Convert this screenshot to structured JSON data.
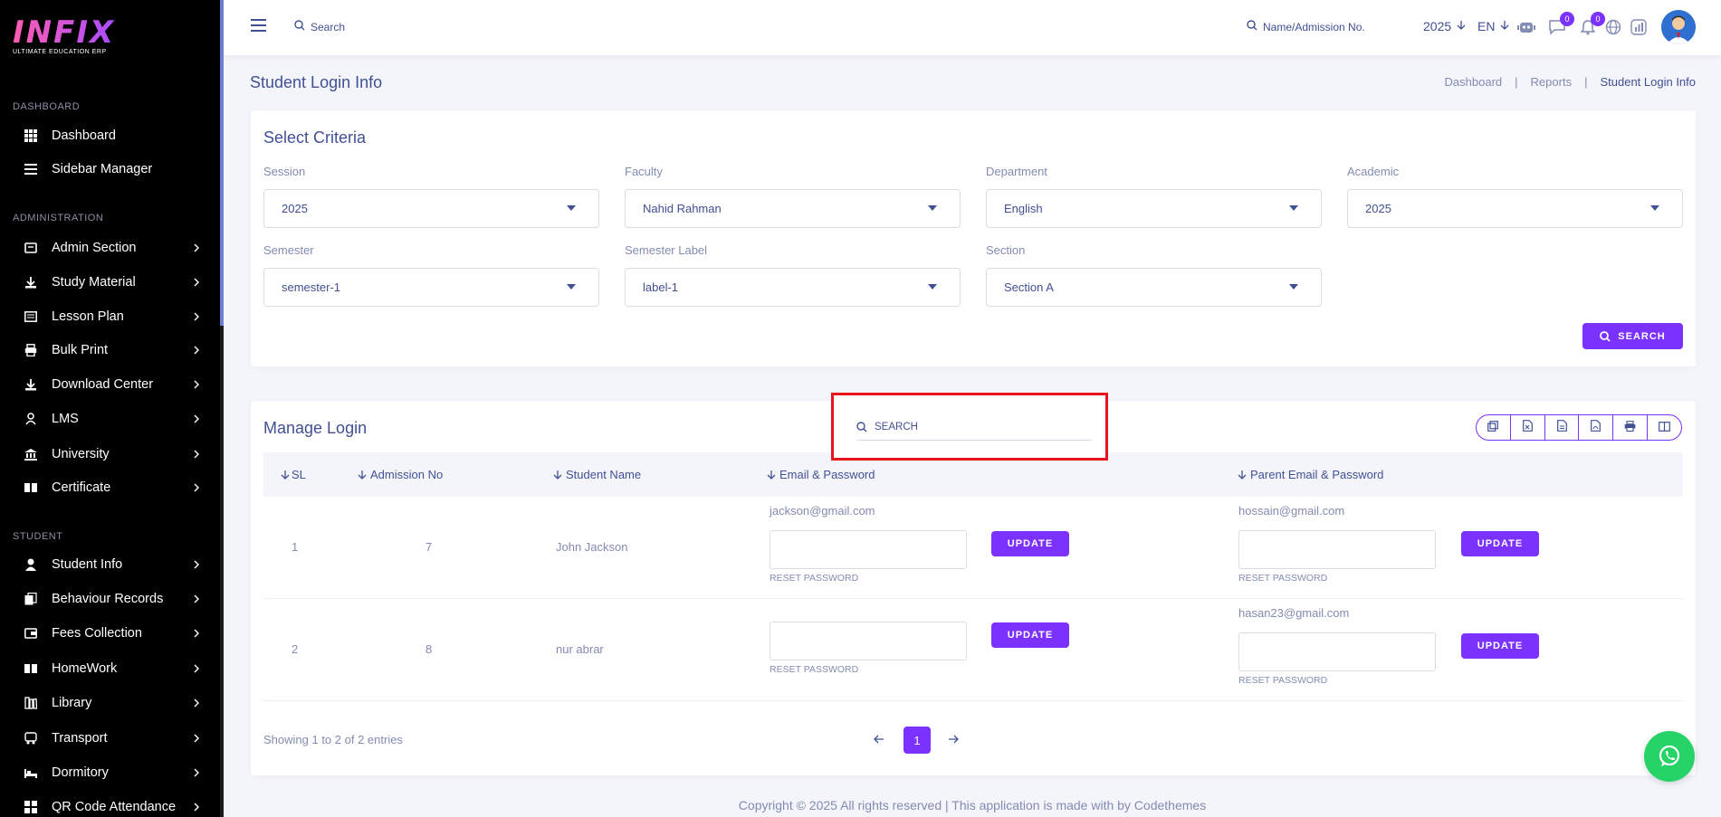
{
  "app": {
    "logo_text": "INFIX",
    "logo_subtitle": "ULTIMATE EDUCATION ERP"
  },
  "sidebar": {
    "sections": {
      "dashboard": "DASHBOARD",
      "administration": "ADMINISTRATION",
      "student": "STUDENT"
    },
    "items": [
      {
        "label": "Dashboard",
        "icon": "grid-icon"
      },
      {
        "label": "Sidebar Manager",
        "icon": "menu-icon"
      },
      {
        "label": "Admin Section",
        "icon": "admin-icon"
      },
      {
        "label": "Study Material",
        "icon": "download-icon"
      },
      {
        "label": "Lesson Plan",
        "icon": "book-icon"
      },
      {
        "label": "Bulk Print",
        "icon": "print-icon"
      },
      {
        "label": "Download Center",
        "icon": "download-icon"
      },
      {
        "label": "LMS",
        "icon": "lms-icon"
      },
      {
        "label": "University",
        "icon": "university-icon"
      },
      {
        "label": "Certificate",
        "icon": "certificate-icon"
      },
      {
        "label": "Student Info",
        "icon": "user-icon"
      },
      {
        "label": "Behaviour Records",
        "icon": "records-icon"
      },
      {
        "label": "Fees Collection",
        "icon": "fees-icon"
      },
      {
        "label": "HomeWork",
        "icon": "homework-icon"
      },
      {
        "label": "Library",
        "icon": "library-icon"
      },
      {
        "label": "Transport",
        "icon": "transport-icon"
      },
      {
        "label": "Dormitory",
        "icon": "bed-icon"
      },
      {
        "label": "QR Code Attendance",
        "icon": "qr-icon"
      }
    ]
  },
  "topbar": {
    "search_placeholder": "Search",
    "admission_search_placeholder": "Name/Admission No.",
    "year": "2025",
    "language": "EN",
    "messages_badge": "0",
    "notifications_badge": "0"
  },
  "page": {
    "title": "Student Login Info",
    "breadcrumb": [
      "Dashboard",
      "Reports",
      "Student Login Info"
    ]
  },
  "criteria": {
    "title": "Select Criteria",
    "fields": [
      {
        "label": "Session",
        "value": "2025"
      },
      {
        "label": "Faculty",
        "value": "Nahid Rahman"
      },
      {
        "label": "Department",
        "value": "English"
      },
      {
        "label": "Academic",
        "value": "2025"
      },
      {
        "label": "Semester",
        "value": "semester-1"
      },
      {
        "label": "Semester Label",
        "value": "label-1"
      },
      {
        "label": "Section",
        "value": "Section A"
      }
    ],
    "search_button": "SEARCH"
  },
  "manage": {
    "title": "Manage Login",
    "table_search_placeholder": "SEARCH",
    "columns": [
      "SL",
      "Admission No",
      "Student Name",
      "Email & Password",
      "Parent Email & Password"
    ],
    "rows": [
      {
        "sl": "1",
        "admission_no": "7",
        "name": "John Jackson",
        "email": "jackson@gmail.com",
        "parent_email": "hossain@gmail.com"
      },
      {
        "sl": "2",
        "admission_no": "8",
        "name": "nur abrar",
        "email": "",
        "parent_email": "hasan23@gmail.com"
      }
    ],
    "update_label": "UPDATE",
    "reset_label": "RESET PASSWORD",
    "showing_text": "Showing 1 to 2 of 2 entries",
    "current_page": "1"
  },
  "footer": {
    "copyright": "Copyright © 2025 All rights reserved | This application is made with by Codethemes"
  },
  "colors": {
    "accent": "#7c32ff",
    "text": "#415094",
    "muted": "#828bb2",
    "highlight": "#e8141c"
  }
}
